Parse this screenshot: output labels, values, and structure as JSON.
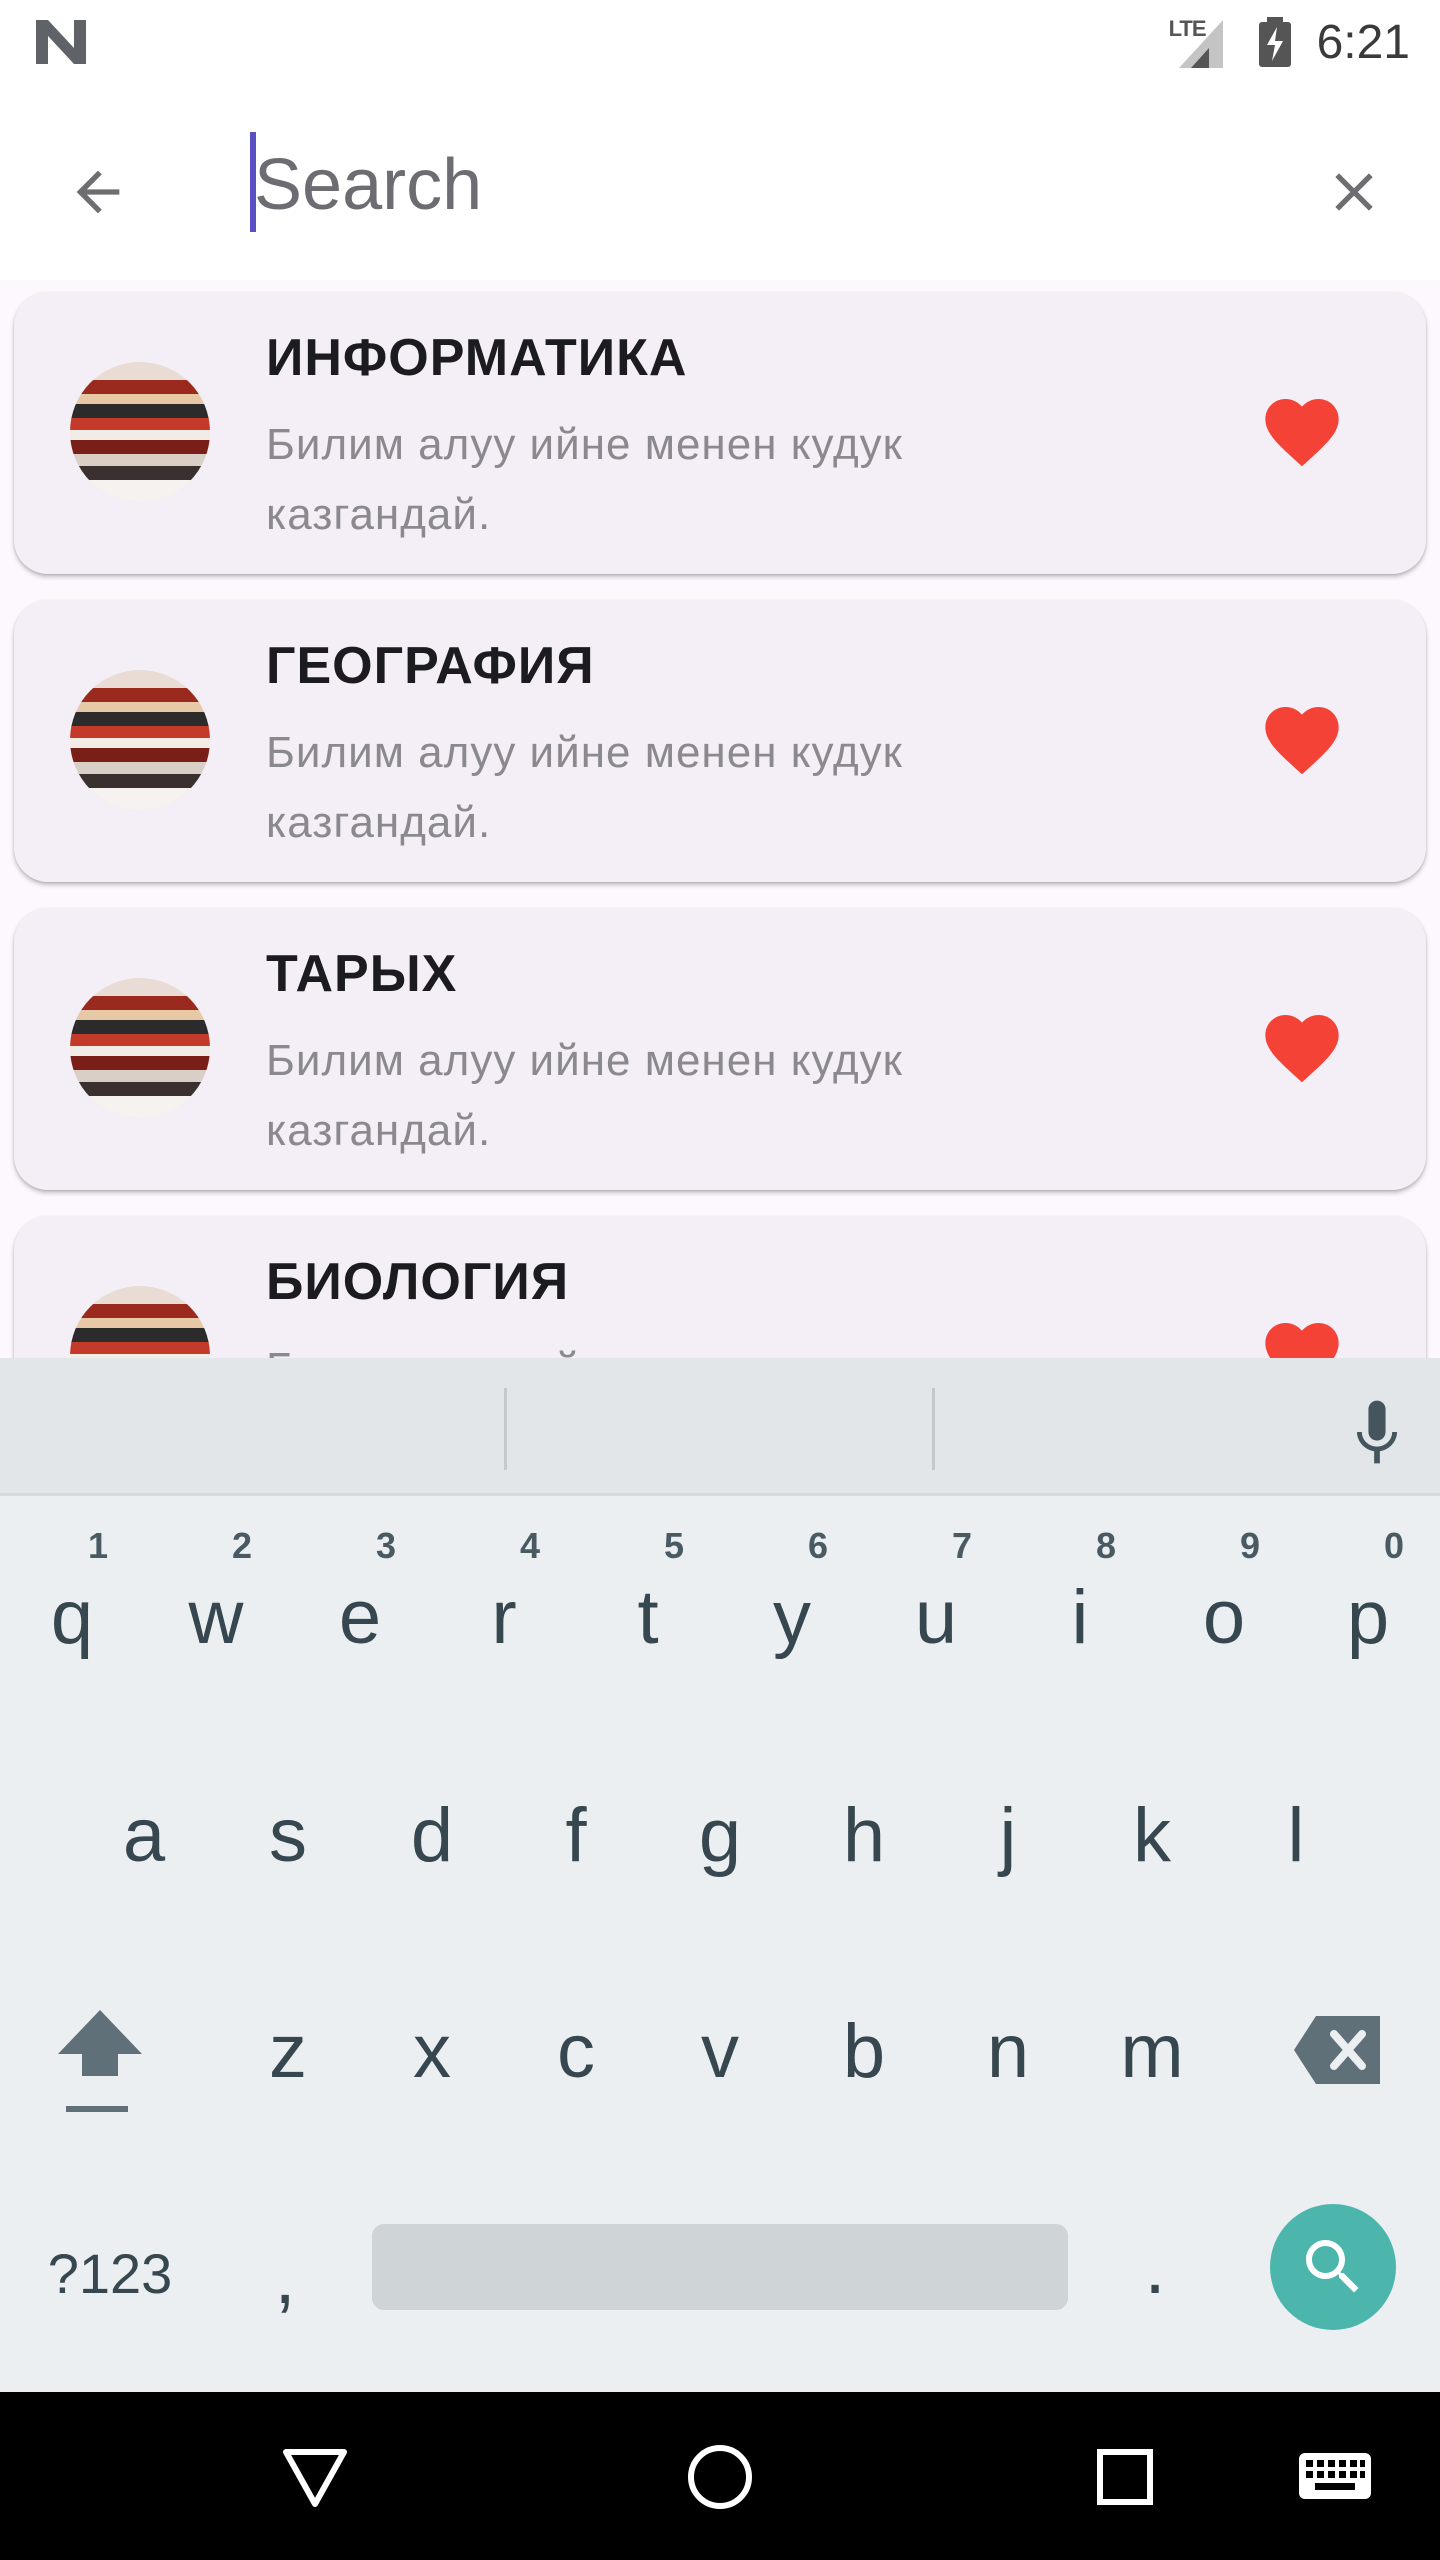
{
  "status_bar": {
    "network": "LTE",
    "time": "6:21",
    "icons": [
      "n-logo-icon",
      "signal-icon",
      "battery-charging-icon"
    ]
  },
  "search": {
    "placeholder": "Search",
    "value": "",
    "back_icon": "arrow-back-icon",
    "clear_icon": "close-icon"
  },
  "items": [
    {
      "title": "ИНФОРМАТИКА",
      "description": "Билим алуу ийне менен кудук казгандай.",
      "favorite": true
    },
    {
      "title": "ГЕОГРАФИЯ",
      "description": "Билим алуу ийне менен кудук казгандай.",
      "favorite": true
    },
    {
      "title": "ТАРЫХ",
      "description": "Билим алуу ийне менен кудук казгандай.",
      "favorite": true
    },
    {
      "title": "БИОЛОГИЯ",
      "description": "Билим алуу ийне менен кудук казгандай.",
      "favorite": true
    }
  ],
  "colors": {
    "accent": "#5a4fc5",
    "card_bg": "#f4eff6",
    "heart": "#f44336",
    "keyboard_action": "#4db6ac"
  },
  "keyboard": {
    "row1": [
      {
        "k": "q",
        "h": "1"
      },
      {
        "k": "w",
        "h": "2"
      },
      {
        "k": "e",
        "h": "3"
      },
      {
        "k": "r",
        "h": "4"
      },
      {
        "k": "t",
        "h": "5"
      },
      {
        "k": "y",
        "h": "6"
      },
      {
        "k": "u",
        "h": "7"
      },
      {
        "k": "i",
        "h": "8"
      },
      {
        "k": "o",
        "h": "9"
      },
      {
        "k": "p",
        "h": "0"
      }
    ],
    "row2": [
      "a",
      "s",
      "d",
      "f",
      "g",
      "h",
      "j",
      "k",
      "l"
    ],
    "row3": [
      "z",
      "x",
      "c",
      "v",
      "b",
      "n",
      "m"
    ],
    "symbols_label": "?123",
    "comma": ",",
    "period": "."
  },
  "nav_bar": {
    "icons": [
      "back-triangle-icon",
      "home-circle-icon",
      "recents-square-icon",
      "keyboard-icon"
    ]
  }
}
